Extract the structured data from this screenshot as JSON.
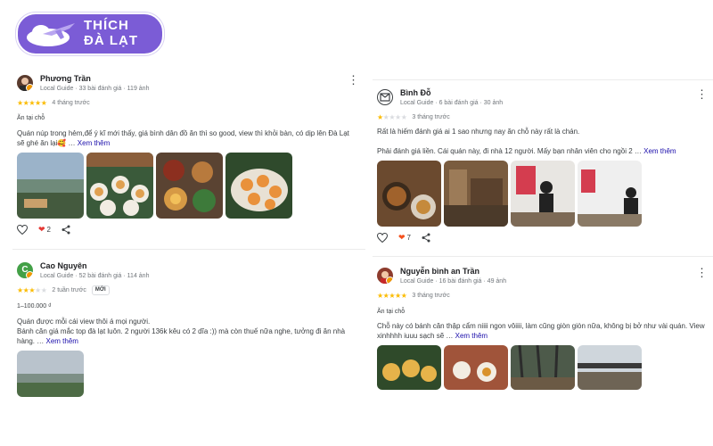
{
  "brand": {
    "line1": "THÍCH",
    "line2": "ĐÀ LẠT",
    "color": "#7b5cd6"
  },
  "reviews": [
    {
      "name": "Phương Trần",
      "meta": "Local Guide · 33 bài đánh giá · 119 ảnh",
      "stars": 5,
      "date": "4 tháng trước",
      "tag": "Ăn tại chỗ",
      "text": "Quán núp trong hẻm,để ý kĩ mới thấy, giá bình dân đồ ăn thì so good, view thì khỏi bàn, có dịp lên Đà Lạt sẽ ghé ăn lại🥰 …",
      "more": "Xem thêm",
      "reaction_count": "2"
    },
    {
      "name": "Cao Nguyên",
      "meta": "Local Guide · 52 bài đánh giá · 114 ảnh",
      "stars": 3,
      "date": "2 tuần trước",
      "badge": "MỚI",
      "price": "1–100.000 ₫",
      "text": "Quán được mỗi cái view thôi á mọi người.\nBánh căn giá mắc top đà lạt luôn. 2 người 136k kêu có 2 dĩa :)) mà còn thuế nữa nghe, tưởng đi ăn nhà hàng. …",
      "more": "Xem thêm"
    },
    {
      "name": "Bình Đỗ",
      "meta": "Local Guide · 6 bài đánh giá · 30 ảnh",
      "stars": 1,
      "date": "3 tháng trước",
      "text": "Rất là hiếm đánh giá ai 1 sao nhưng nay ăn chỗ này rất là chán.\n\nPhải đánh giá liền. Cái quán này, đi nhà 12 người. Mấy bạn nhân viên cho ngồi 2 …",
      "more": "Xem thêm",
      "reaction_count": "7"
    },
    {
      "name": "Nguyễn bình an Trần",
      "meta": "Local Guide · 16 bài đánh giá · 49 ảnh",
      "stars": 5,
      "date": "3 tháng trước",
      "tag": "Ăn tại chỗ",
      "text": "Chỗ này có bánh căn thập cẩm niiii ngon vôiiii, làm cũng giòn giòn nữa, không bị bở như vài quán. View xinhhhh iuuu sạch sẽ …",
      "more": "Xem thêm"
    }
  ]
}
